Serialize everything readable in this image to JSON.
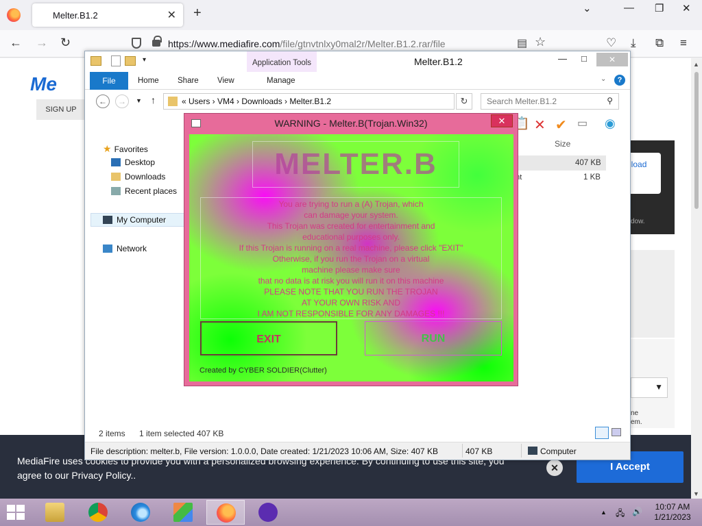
{
  "browser": {
    "tab_title": "Melter.B1.2",
    "url_host": "https://www.mediafire.com",
    "url_path": "/file/gtnvtnlxy0mal2r/Melter.B1.2.rar/file"
  },
  "mediafire": {
    "logo": "Me",
    "signup": "SIGN UP",
    "download": "nload",
    "hint": "dow.",
    "side_text_1": "ne",
    "side_text_2": "em.",
    "cookie_text": "MediaFire uses cookies to provide you with a personalized browsing experience. By continuing to use this site, you agree to our Privacy Policy..",
    "accept": "I Accept"
  },
  "explorer": {
    "title": "Melter.B1.2",
    "app_tools": "Application Tools",
    "ribbon_tabs": [
      "File",
      "Home",
      "Share",
      "View",
      "Manage"
    ],
    "breadcrumb": "«   Users   ›   VM4   ›   Downloads   ›   Melter.B1.2",
    "search_placeholder": "Search Melter.B1.2",
    "nav": {
      "favorites": "Favorites",
      "desktop": "Desktop",
      "downloads": "Downloads",
      "recent": "Recent places",
      "my_computer": "My Computer",
      "network": "Network"
    },
    "columns": {
      "size": "Size"
    },
    "rows": [
      {
        "size": "407 KB",
        "type": ""
      },
      {
        "size": "1 KB",
        "type": "ent"
      }
    ],
    "status": {
      "items": "2 items",
      "selected": "1 item selected  407 KB"
    },
    "details": {
      "description": "File description: melter.b, File version: 1.0.0.0, Date created: 1/21/2023 10:06 AM, Size: 407 KB",
      "size": "407 KB",
      "location": "Computer"
    }
  },
  "melter": {
    "title": "WARNING - Melter.B(Trojan.Win32)",
    "logo": "MELTER.B",
    "lines": [
      "You are trying to run a (A) Trojan, which",
      "can damage your system.",
      "This Trojan was created for entertainment and",
      "educational purposes only.",
      "If this Trojan is running on a real machine, please click \"EXIT\"",
      "Otherwise, if you run the Trojan on a virtual",
      "machine please make sure",
      "that no data is at risk you will run it on this machine",
      "PLEASE NOTE THAT YOU RUN THE TROJAN",
      "AT YOUR OWN RISK AND",
      "I AM NOT RESPONSIBLE FOR ANY DAMAGES !!!"
    ],
    "exit": "EXIT",
    "run": "RUN",
    "credit": "Created by CYBER SOLDIER(Clutter)"
  },
  "taskbar": {
    "time": "10:07 AM",
    "date": "1/21/2023"
  }
}
